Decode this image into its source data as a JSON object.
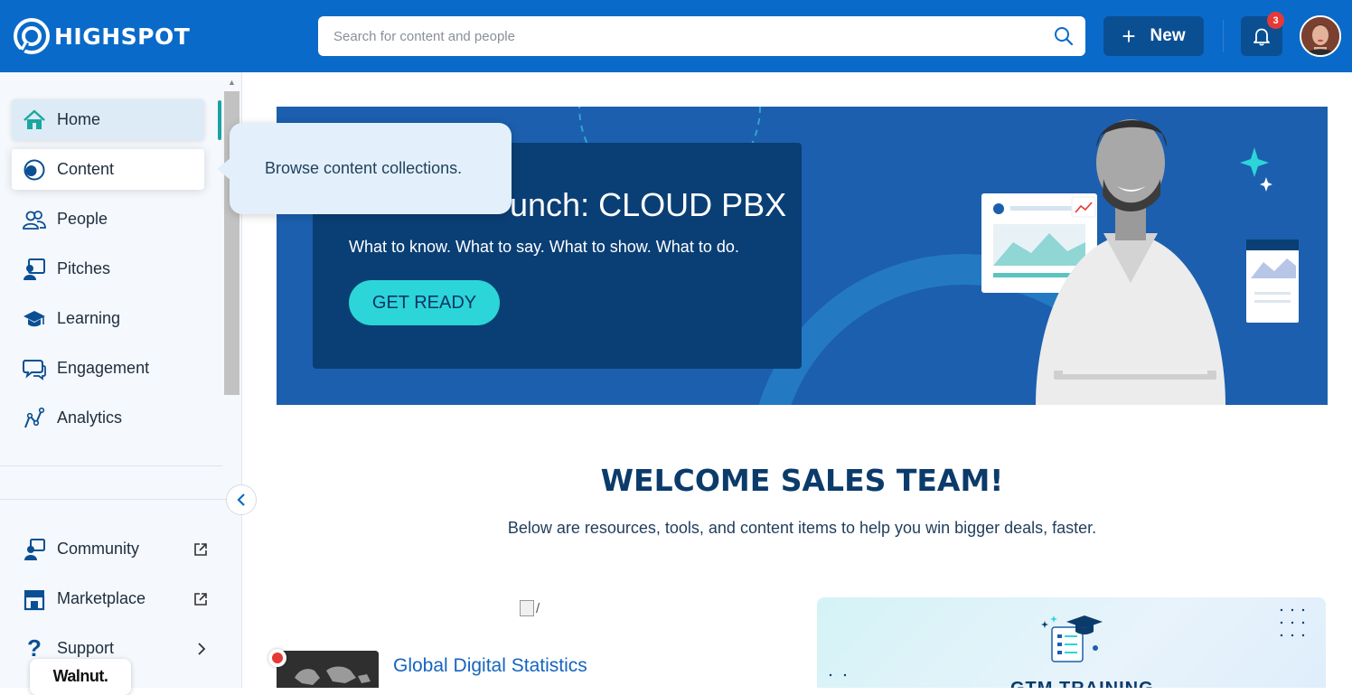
{
  "header": {
    "logo_text": "HIGHSPOT",
    "search_placeholder": "Search for content and people",
    "new_label": "New",
    "notifications_count": "3"
  },
  "sidebar": {
    "items": [
      {
        "label": "Home"
      },
      {
        "label": "Content"
      },
      {
        "label": "People"
      },
      {
        "label": "Pitches"
      },
      {
        "label": "Learning"
      },
      {
        "label": "Engagement"
      },
      {
        "label": "Analytics"
      }
    ],
    "footer_items": [
      {
        "label": "Community"
      },
      {
        "label": "Marketplace"
      },
      {
        "label": "Support"
      }
    ],
    "walnut_label": "Walnut."
  },
  "tooltip": {
    "text": "Browse content collections."
  },
  "hero": {
    "title": "unch: CLOUD PBX",
    "subtitle": "What to know. What to say. What to show. What to do.",
    "button_label": "GET READY"
  },
  "welcome": {
    "heading": "WELCOME SALES TEAM!",
    "subheading": "Below are resources, tools, and content items to help you win bigger deals, faster."
  },
  "cards": {
    "broken_image_alt": "/",
    "first_title": "Global Digital Statistics",
    "second_title": "GTM TRAINING"
  },
  "colors": {
    "topbar": "#0a6ac9",
    "accent_teal": "#2cd5d8",
    "hero_blue": "#1c5fae",
    "heading_navy": "#0b3b6b"
  }
}
